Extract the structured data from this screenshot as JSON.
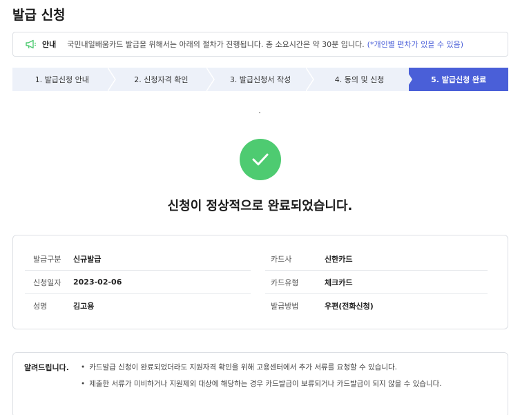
{
  "page": {
    "title": "발급 신청"
  },
  "notice": {
    "label": "안내",
    "text": "국민내일배움카드 발급을 위해서는 아래의 절차가 진행됩니다. 총 소요시간은 약 30분 입니다.",
    "highlight": "(*개인별 편차가 있을 수 있음)",
    "icon": "megaphone-icon"
  },
  "steps": [
    {
      "label": "1. 발급신청 안내",
      "active": false
    },
    {
      "label": "2. 신청자격 확인",
      "active": false
    },
    {
      "label": "3. 발급신청서 작성",
      "active": false
    },
    {
      "label": "4. 동의 및 신청",
      "active": false
    },
    {
      "label": "5. 발급신청 완료",
      "active": true
    }
  ],
  "result": {
    "message": "신청이 정상적으로 완료되었습니다.",
    "icon": "check-icon",
    "icon_color": "#4ecb71"
  },
  "info": {
    "left": [
      {
        "label": "발급구분",
        "value": "신규발급"
      },
      {
        "label": "신청일자",
        "value": "2023-02-06"
      },
      {
        "label": "성명",
        "value": "김고용"
      }
    ],
    "right": [
      {
        "label": "카드사",
        "value": "신한카드"
      },
      {
        "label": "카드유형",
        "value": "체크카드"
      },
      {
        "label": "발급방법",
        "value": "우편(전화신청)"
      }
    ]
  },
  "notes": {
    "title": "알려드립니다.",
    "items": [
      "카드발급 신청이 완료되었더라도 지원자격 확인을 위해 고용센터에서 추가 서류를 요청할 수 있습니다.",
      "제출한 서류가 미비하거나 지원제외 대상에 해당하는 경우 카드발급이 보류되거나 카드발급이 되지 않을 수 있습니다."
    ]
  },
  "colors": {
    "accent": "#4a5fd8",
    "step_bg": "#edf1f9",
    "success": "#4ecb71"
  }
}
